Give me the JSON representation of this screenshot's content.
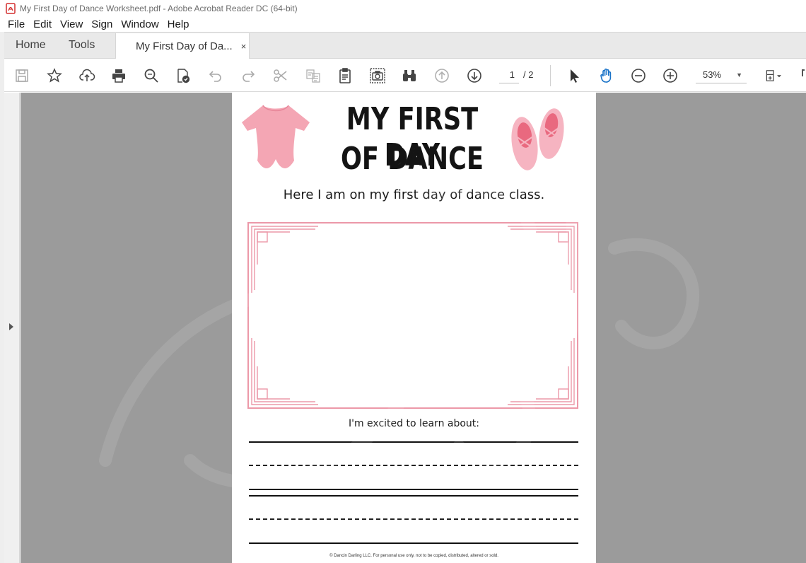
{
  "window": {
    "title": "My First Day of Dance  Worksheet.pdf - Adobe Acrobat Reader DC (64-bit)",
    "app_icon": "acrobat-pdf-icon"
  },
  "menu": [
    "File",
    "Edit",
    "View",
    "Sign",
    "Window",
    "Help"
  ],
  "tabs": {
    "home": "Home",
    "tools": "Tools",
    "document": "My First Day of Da...",
    "close_glyph": "×"
  },
  "toolbar": {
    "icons": [
      "save-icon",
      "bookmark-star-icon",
      "upload-cloud-icon",
      "print-icon",
      "search-zoom-icon",
      "fill-sign-icon",
      "undo-icon",
      "redo-icon",
      "scissors-icon",
      "export-text-icon",
      "clipboard-icon",
      "snapshot-camera-icon",
      "find-binoculars-icon",
      "page-up-icon",
      "page-down-icon",
      "select-pointer-icon",
      "hand-tool-icon",
      "zoom-out-icon",
      "zoom-in-icon",
      "fit-page-icon"
    ],
    "current_page": "1",
    "total_pages": "/ 2",
    "zoom": "53%"
  },
  "document": {
    "heading_line1": "MY FIRST DAY",
    "heading_line2": "OF DANCE",
    "subtitle": "Here I am on my  first day of dance class.",
    "prompt": "I'm excited to learn about:",
    "footer": "© Dancin Darling LLC. For personal use only, not to be copied, distributed, altered or sold.",
    "watermark_text": "Dancin Darling",
    "colors": {
      "accent_pink": "#f0a3b3",
      "frame_pink": "#e88ea0",
      "leotard_pink": "#f4a6b4"
    }
  }
}
